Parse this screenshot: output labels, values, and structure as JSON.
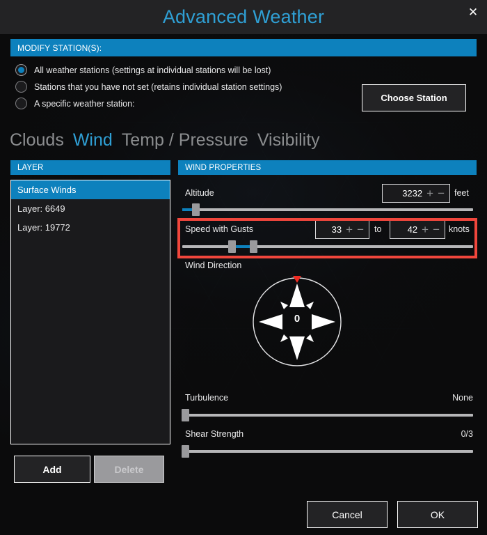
{
  "window": {
    "title": "Advanced Weather",
    "close_icon": "close-icon"
  },
  "modify_stations": {
    "header": "MODIFY STATION(S):",
    "options": [
      {
        "label": "All weather stations (settings at individual stations will be lost)",
        "selected": true
      },
      {
        "label": "Stations that you have not set (retains individual station settings)",
        "selected": false
      },
      {
        "label": "A specific weather station:",
        "selected": false
      }
    ],
    "choose_station_label": "Choose Station"
  },
  "tabs": [
    {
      "label": "Clouds",
      "active": false
    },
    {
      "label": "Wind",
      "active": true
    },
    {
      "label": "Temp / Pressure",
      "active": false
    },
    {
      "label": "Visibility",
      "active": false
    }
  ],
  "layer_panel": {
    "header": "LAYER",
    "items": [
      {
        "label": "Surface Winds",
        "selected": true
      },
      {
        "label": "Layer: 6649",
        "selected": false
      },
      {
        "label": "Layer: 19772",
        "selected": false
      }
    ],
    "add_label": "Add",
    "delete_label": "Delete"
  },
  "wind_properties": {
    "header": "WIND PROPERTIES",
    "altitude": {
      "label": "Altitude",
      "value": "3232",
      "unit": "feet",
      "plus": "+",
      "minus": "−",
      "slider_percent": 4
    },
    "speed_with_gusts": {
      "label": "Speed with Gusts",
      "min_value": "33",
      "max_value": "42",
      "separator": "to",
      "unit": "knots",
      "plus": "+",
      "minus": "−",
      "slider_low_percent": 17,
      "slider_high_percent": 22,
      "highlighted": true,
      "highlight_color": "#f0463c"
    },
    "wind_direction": {
      "label": "Wind Direction",
      "value": "0",
      "marker_icon": "north-marker-icon"
    },
    "turbulence": {
      "label": "Turbulence",
      "value": "None",
      "slider_percent": 0
    },
    "shear_strength": {
      "label": "Shear Strength",
      "value": "0/3",
      "slider_percent": 0
    }
  },
  "footer": {
    "cancel_label": "Cancel",
    "ok_label": "OK"
  },
  "colors": {
    "accent": "#0d81bd",
    "title": "#2f9fd4",
    "highlight": "#f0463c",
    "background": "#0b0b0c"
  }
}
